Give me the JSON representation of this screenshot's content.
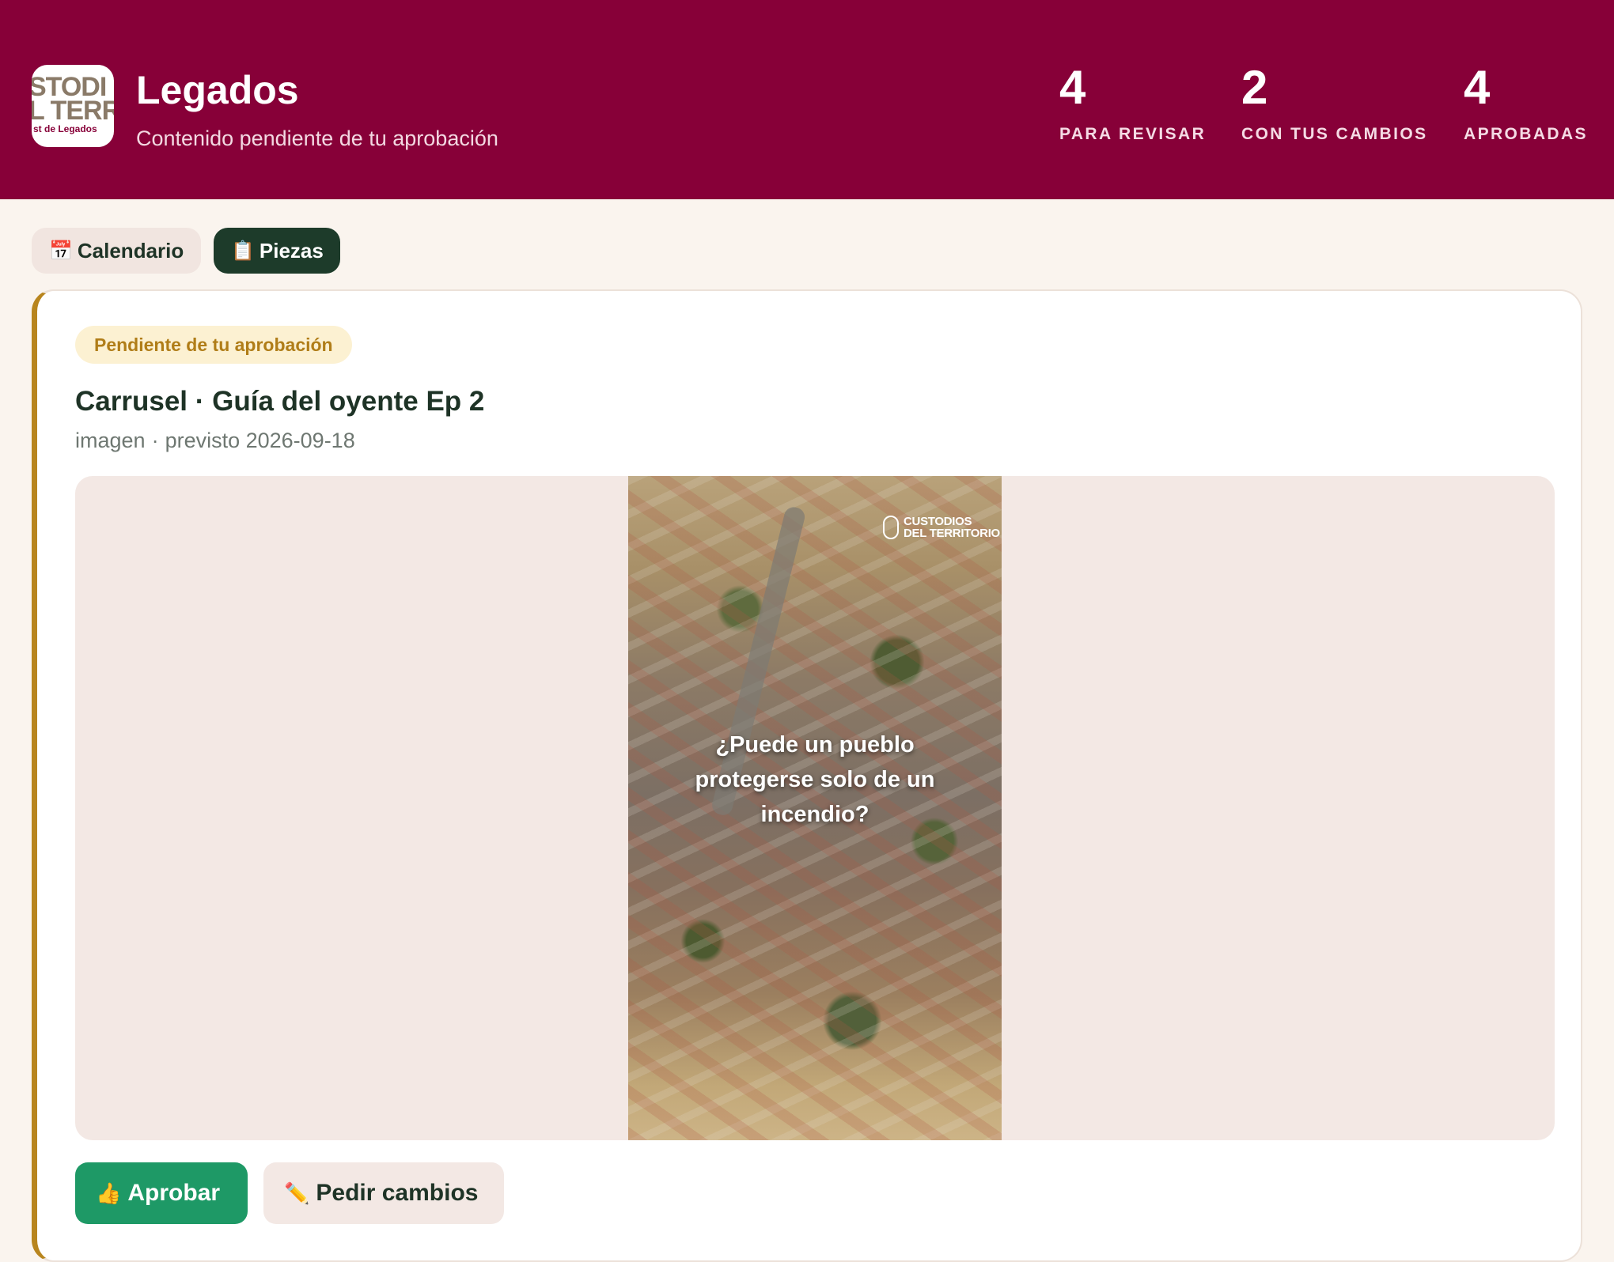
{
  "header": {
    "logo": {
      "line1": "STODI",
      "line2": "L TERR",
      "line3": "st de Legados"
    },
    "title": "Legados",
    "subtitle": "Contenido pendiente de tu aprobación",
    "stats": [
      {
        "value": "4",
        "label": "PARA REVISAR"
      },
      {
        "value": "2",
        "label": "CON TUS CAMBIOS"
      },
      {
        "value": "4",
        "label": "APROBADAS"
      }
    ]
  },
  "tabs": [
    {
      "icon": "📅",
      "label": "Calendario",
      "active": false
    },
    {
      "icon": "📋",
      "label": "Piezas",
      "active": true
    }
  ],
  "card": {
    "status": "Pendiente de tu aprobación",
    "title": "Carrusel · Guía del oyente Ep 2",
    "type": "imagen",
    "separator": "·",
    "planned": "previsto 2026-09-18",
    "image": {
      "brand_line1": "CUSTODIOS",
      "brand_line2": "DEL TERRITORIO",
      "caption": "¿Puede un pueblo protegerse solo de un incendio?"
    },
    "actions": {
      "approve_icon": "👍",
      "approve_label": "Aprobar",
      "changes_icon": "✏️",
      "changes_label": "Pedir cambios"
    }
  },
  "colors": {
    "header_bg": "#870038",
    "page_bg": "#faf4ee",
    "active_tab": "#1d3b2a",
    "approve": "#1e9966",
    "pending_accent": "#b8851e"
  }
}
